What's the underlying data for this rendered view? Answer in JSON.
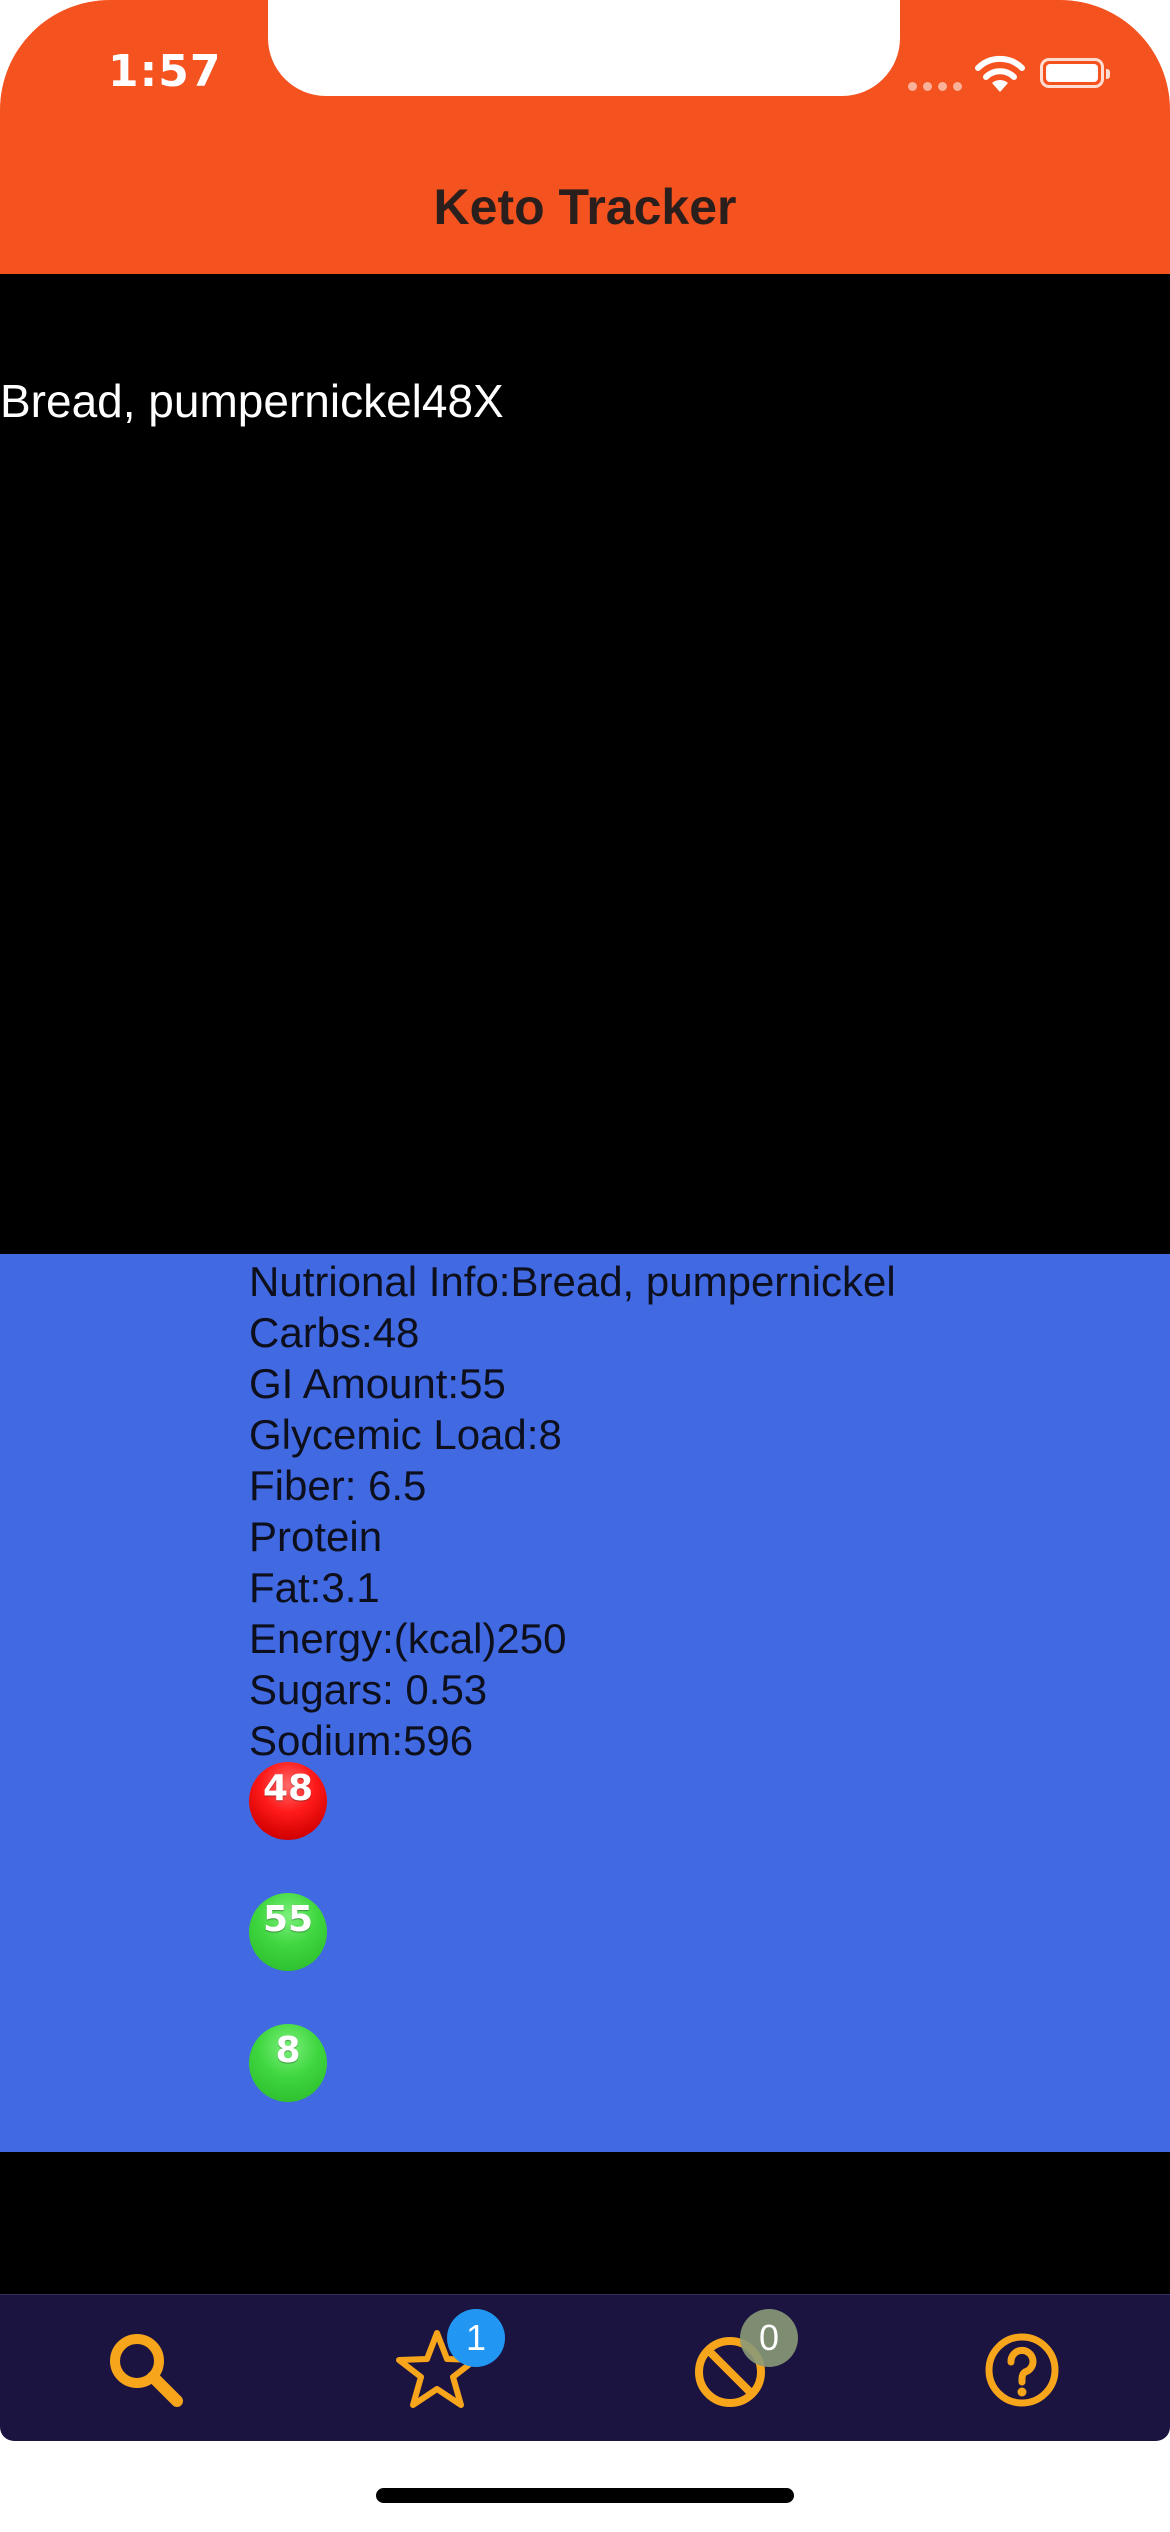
{
  "status_bar": {
    "time": "1:57"
  },
  "nav": {
    "title": "Keto Tracker"
  },
  "food_list": {
    "items": [
      {
        "label": "Bread, pumpernickel48X"
      }
    ]
  },
  "detail": {
    "lines": [
      "Nutrional Info:Bread, pumpernickel",
      "Carbs:48",
      "GI Amount:55",
      "Glycemic Load:8",
      "Fiber: 6.5",
      "Protein",
      "Fat:3.1",
      "Energy:(kcal)250",
      "Sugars: 0.53",
      "Sodium:596"
    ],
    "indicators": [
      {
        "value": "48",
        "color": "#ff1a1a"
      },
      {
        "value": "55",
        "color": "#3ed63e"
      },
      {
        "value": "8",
        "color": "#3ed63e"
      }
    ]
  },
  "colors": {
    "header": "#f4521e",
    "detail_panel": "#4169e1",
    "tabbar": "#1b1340",
    "tab_icon": "#f7a51b",
    "favorites_badge": "#2196f3",
    "blocked_badge": "#8a9a78"
  },
  "tabbar": {
    "tabs": [
      {
        "icon": "search-icon"
      },
      {
        "icon": "star-icon",
        "badge": "1"
      },
      {
        "icon": "blocked-icon",
        "badge": "0"
      },
      {
        "icon": "help-icon"
      }
    ]
  }
}
